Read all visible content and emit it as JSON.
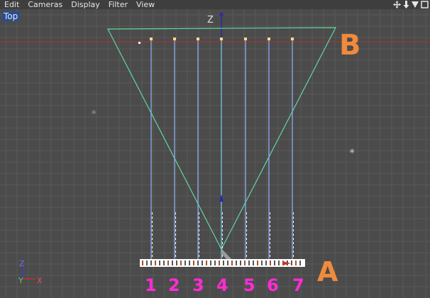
{
  "menu": {
    "items": [
      "Edit",
      "Cameras",
      "Display",
      "Filter",
      "View"
    ]
  },
  "toolbar": {
    "icons": [
      "move-view-icon",
      "scroll-view-icon",
      "zoom-view-icon",
      "maximize-view-icon"
    ]
  },
  "viewport": {
    "label": "Top",
    "axis_label": "Z"
  },
  "annotations": {
    "marker_b": "B",
    "marker_a": "A",
    "numbers": [
      "1",
      "2",
      "3",
      "4",
      "5",
      "6",
      "7"
    ]
  },
  "axis_gizmo": {
    "z": "Z",
    "y": "Y",
    "x": "X"
  },
  "colors": {
    "background": "#4b4b4b",
    "grid": "#5a5a5a",
    "horizon_line": "#b03030",
    "frustum": "#5fd9a0",
    "light_lines": "#8fb4ff",
    "annotation_orange": "#f08a3c",
    "annotation_magenta": "#ff2bd6"
  }
}
